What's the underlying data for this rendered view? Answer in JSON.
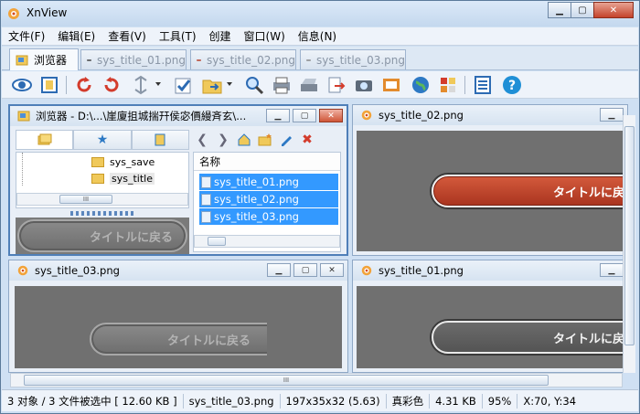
{
  "window": {
    "title": "XnView"
  },
  "menu": [
    "文件(F)",
    "编辑(E)",
    "查看(V)",
    "工具(T)",
    "创建",
    "窗口(W)",
    "信息(N)"
  ],
  "tabs": [
    {
      "label": "浏览器",
      "active": true
    },
    {
      "label": "sys_title_01.png",
      "active": false
    },
    {
      "label": "sys_title_02.png",
      "active": false
    },
    {
      "label": "sys_title_03.png",
      "active": false
    }
  ],
  "toolbar_icons": [
    "eye-icon",
    "fullscreen-icon",
    "rotate-left-icon",
    "rotate-right-icon",
    "flip-icon",
    "checkmark-icon",
    "folder-open-icon",
    "zoom-icon",
    "print-icon",
    "scanner-icon",
    "export-icon",
    "camera-icon",
    "slideshow-icon",
    "web-icon",
    "palette-icon",
    "properties-icon",
    "help-icon"
  ],
  "browser_pane": {
    "title": "浏览器 - D:\\...\\崖廈抯城揣幵侯宓價縵斉玄\\...",
    "tree": [
      "sys_save",
      "sys_title"
    ],
    "column_header": "名称",
    "files": [
      "sys_title_01.png",
      "sys_title_02.png",
      "sys_title_03.png"
    ],
    "preview_button": "タイトルに戻る"
  },
  "panes": {
    "p02": {
      "title": "sys_title_02.png",
      "button_text": "タイトルに戻る"
    },
    "p03": {
      "title": "sys_title_03.png",
      "button_text": "タイトルに戻る"
    },
    "p01": {
      "title": "sys_title_01.png",
      "button_text": "タイトルに戻る"
    }
  },
  "scroll_grip": "III",
  "status": {
    "selection": "3 对象 / 3 文件被选中 [ 12.60 KB ]",
    "filename": "sys_title_03.png",
    "dimensions": "197x35x32 (5.63)",
    "color": "真彩色",
    "size": "4.31 KB",
    "zoom": "95%",
    "coords": "X:70, Y:34"
  },
  "colors": {
    "selection": "#3399ff",
    "frame": "#cfe0f3",
    "image_bg": "#707070",
    "red_button": "#c2452b"
  }
}
